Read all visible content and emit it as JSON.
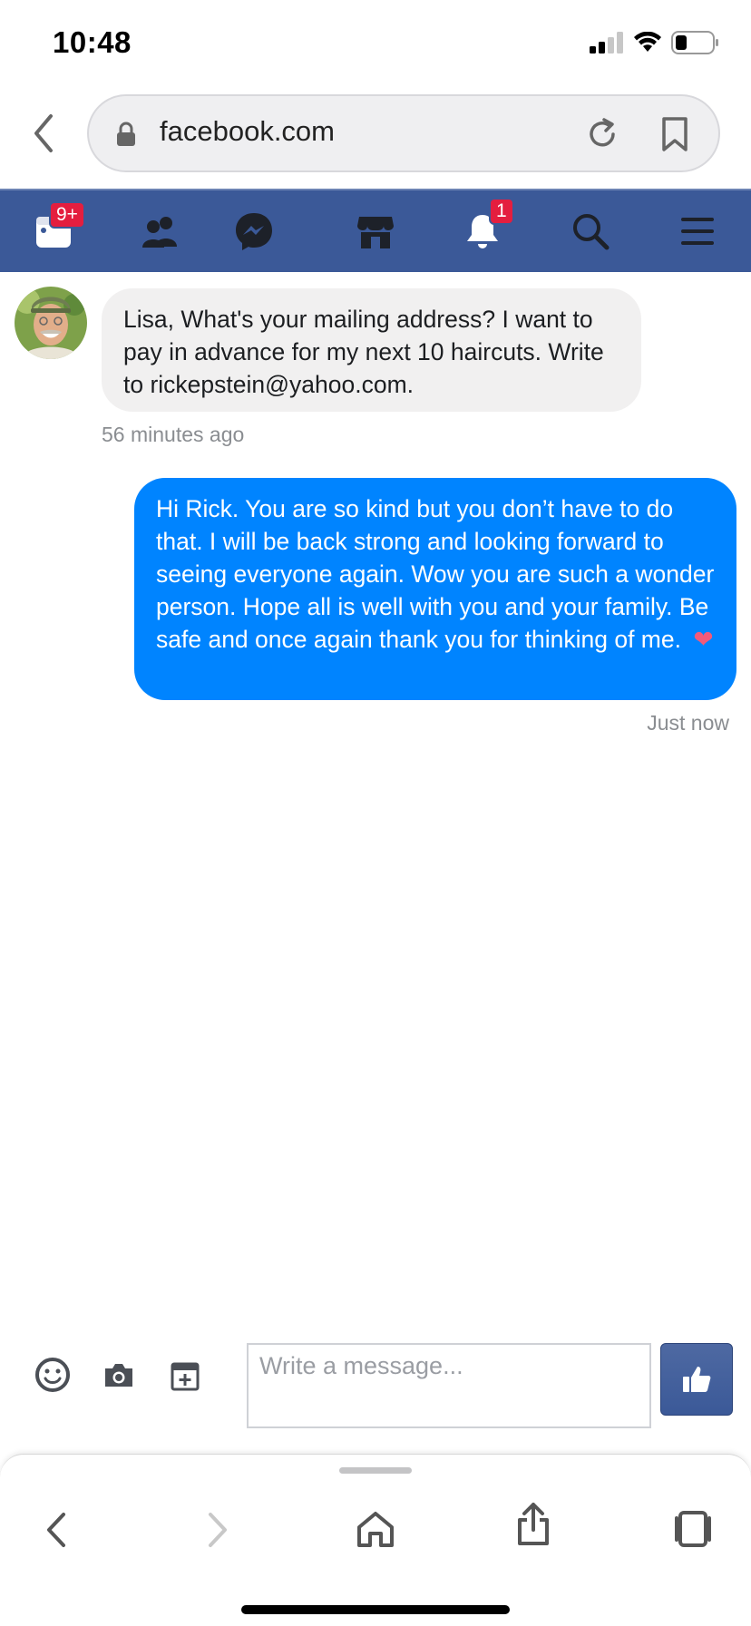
{
  "status_bar": {
    "time": "10:48"
  },
  "browser": {
    "url": "facebook.com"
  },
  "fb_nav": {
    "items": [
      {
        "name": "feed",
        "badge": "9+"
      },
      {
        "name": "friends",
        "badge": ""
      },
      {
        "name": "messenger",
        "badge": ""
      },
      {
        "name": "marketplace",
        "badge": ""
      },
      {
        "name": "notifications",
        "badge": "1"
      },
      {
        "name": "search",
        "badge": ""
      },
      {
        "name": "menu",
        "badge": ""
      }
    ]
  },
  "conversation": {
    "incoming": {
      "text": "Lisa, What's your mailing address? I want to pay in advance for my next 10 haircuts. Write to rickepstein@yahoo.com.",
      "timestamp": "56 minutes ago"
    },
    "outgoing": {
      "text": "Hi Rick.  You are so kind but you don’t have to do that.  I will be back strong and looking forward to seeing everyone again.  Wow you are such a wonder person.  Hope all is well with you and your family.  Be safe and once again thank you for thinking of me.",
      "emoji": "❤",
      "timestamp": "Just now"
    }
  },
  "composer": {
    "placeholder": "Write a message..."
  },
  "colors": {
    "fb_blue": "#3b5998",
    "messenger_blue": "#0084ff",
    "badge_red": "#e41e3f",
    "incoming_bubble": "#f1f0f0"
  }
}
